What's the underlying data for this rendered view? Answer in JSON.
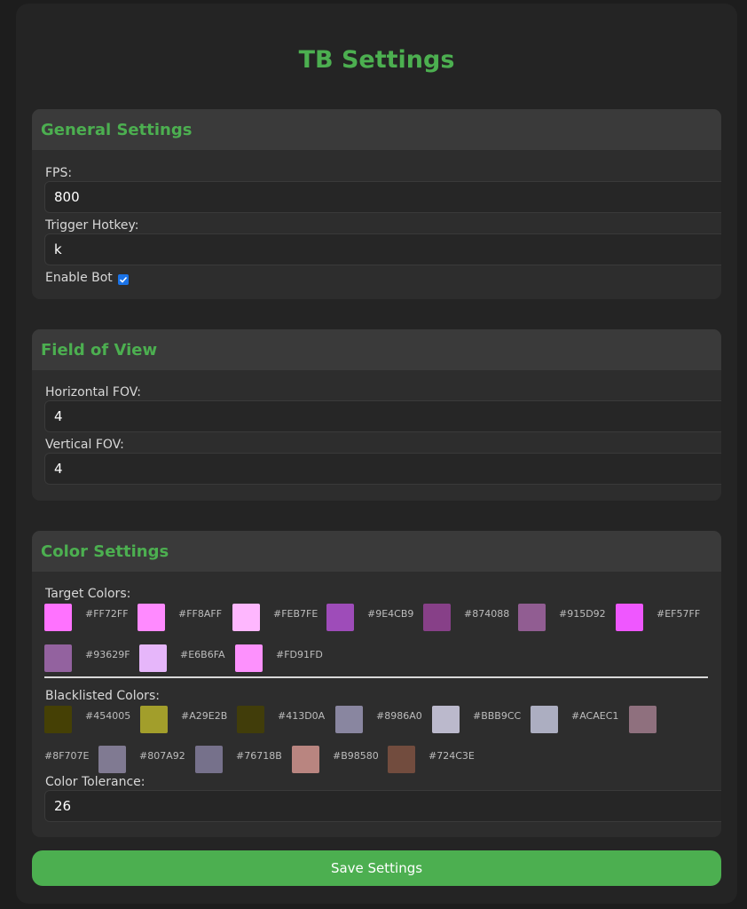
{
  "page": {
    "title": "TB Settings"
  },
  "general": {
    "header": "General Settings",
    "fps_label": "FPS:",
    "fps_value": "800",
    "hotkey_label": "Trigger Hotkey:",
    "hotkey_value": "k",
    "enable_label": "Enable Bot",
    "enable_checked": true
  },
  "fov": {
    "header": "Field of View",
    "h_label": "Horizontal FOV:",
    "h_value": "4",
    "v_label": "Vertical FOV:",
    "v_value": "4"
  },
  "color": {
    "header": "Color Settings",
    "target_label": "Target Colors:",
    "target_colors": [
      "#FF72FF",
      "#FF8AFF",
      "#FEB7FE",
      "#9E4CB9",
      "#874088",
      "#915D92",
      "#EF57FF",
      "#93629F",
      "#E6B6FA",
      "#FD91FD"
    ],
    "blacklist_label": "Blacklisted Colors:",
    "blacklist_colors": [
      "#454005",
      "#A29E2B",
      "#413D0A",
      "#8986A0",
      "#BBB9CC",
      "#ACAEC1",
      "#8F707E",
      "#807A92",
      "#76718B",
      "#B98580",
      "#724C3E"
    ],
    "tolerance_label": "Color Tolerance:",
    "tolerance_value": "26"
  },
  "save_label": "Save Settings"
}
